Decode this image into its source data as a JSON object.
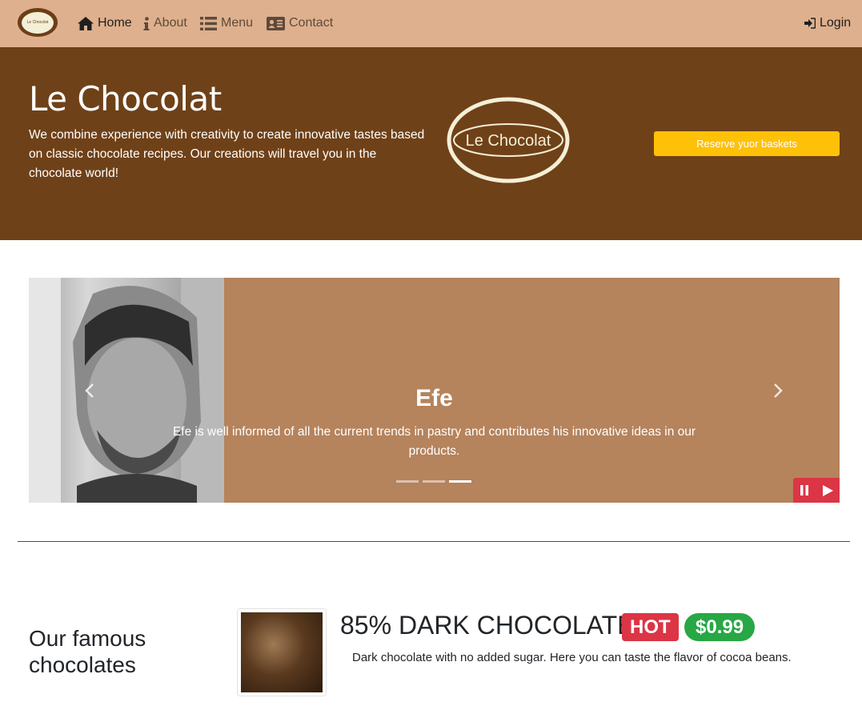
{
  "nav": {
    "brand_text": "Le Chocolat",
    "items": [
      {
        "label": "Home",
        "icon": "home-icon",
        "active": true
      },
      {
        "label": "About",
        "icon": "info-icon"
      },
      {
        "label": "Menu",
        "icon": "list-icon"
      },
      {
        "label": "Contact",
        "icon": "address-card-icon"
      }
    ],
    "login_label": "Login"
  },
  "hero": {
    "title": "Le Chocolat",
    "text": "We combine experience with creativity to create innovative tastes based on classic chocolate recipes. Our creations will travel you in the chocolate world!",
    "logo_text": "Le Chocolat",
    "reserve_label": "Reserve yuor baskets"
  },
  "carousel": {
    "title": "Efe",
    "text": "Efe is well informed of all the current trends in pastry and contributes his innovative ideas in our products.",
    "indicator_count": 3,
    "active_index": 2
  },
  "famous": {
    "title": "Our famous chocolates",
    "product": {
      "name": "85% DARK CHOCOLATE",
      "badge": "HOT",
      "price": "$0.99",
      "description": "Dark chocolate with no added sugar. Here you can taste the flavor of cocoa beans."
    }
  },
  "colors": {
    "navbar": "#deb08d",
    "hero": "#6f4118",
    "carousel": "#b5835c",
    "reserve_button": "#ffc107",
    "hot_badge": "#dc3545",
    "price_badge": "#28a745"
  }
}
